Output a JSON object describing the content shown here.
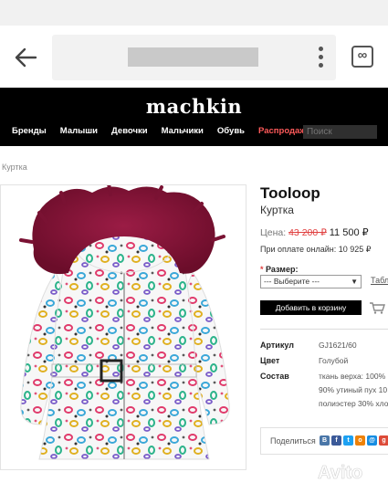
{
  "browser": {
    "back_icon": "arrow-left-icon",
    "menu_icon": "more-vertical-icon",
    "tabs_label": "∞"
  },
  "site": {
    "logo": "machkin",
    "nav": [
      "Бренды",
      "Малыши",
      "Девочки",
      "Мальчики",
      "Обувь",
      "Распродажа"
    ],
    "search_placeholder": "Поиск",
    "colors": {
      "header_bg": "#000000",
      "sale": "#ff5a5a",
      "old_price": "#e04040"
    }
  },
  "breadcrumb": "Куртка",
  "product": {
    "brand": "Tooloop",
    "type": "Куртка",
    "price_label": "Цена:",
    "old_price": "43 200 ₽",
    "new_price": "11 500 ₽",
    "online_price": "При оплате онлайн: 10 925 ₽",
    "size_label": "Размер:",
    "size_required_mark": "*",
    "size_select": "--- Выберите ---",
    "size_table_link": "Таблица",
    "add_to_cart": "Добавить в корзину",
    "specs": [
      {
        "label": "Артикул",
        "value": "GJ1621/60"
      },
      {
        "label": "Цвет",
        "value": "Голубой"
      },
      {
        "label": "Состав",
        "value": "ткань верха: 100%"
      }
    ],
    "composition_extra": [
      "90% утиный пух 10",
      "полиэстер 30% хло"
    ],
    "share_label": "Поделиться",
    "share_icons": [
      {
        "name": "vk-icon",
        "glyph": "В",
        "color": "#4a76a8"
      },
      {
        "name": "facebook-icon",
        "glyph": "f",
        "color": "#3b5998"
      },
      {
        "name": "twitter-icon",
        "glyph": "t",
        "color": "#1da1f2"
      },
      {
        "name": "odnoklassniki-icon",
        "glyph": "о",
        "color": "#ee8208"
      },
      {
        "name": "mailru-icon",
        "glyph": "@",
        "color": "#168de2"
      },
      {
        "name": "google-plus-icon",
        "glyph": "g",
        "color": "#dd4b39"
      }
    ]
  },
  "watermark": "Avito"
}
